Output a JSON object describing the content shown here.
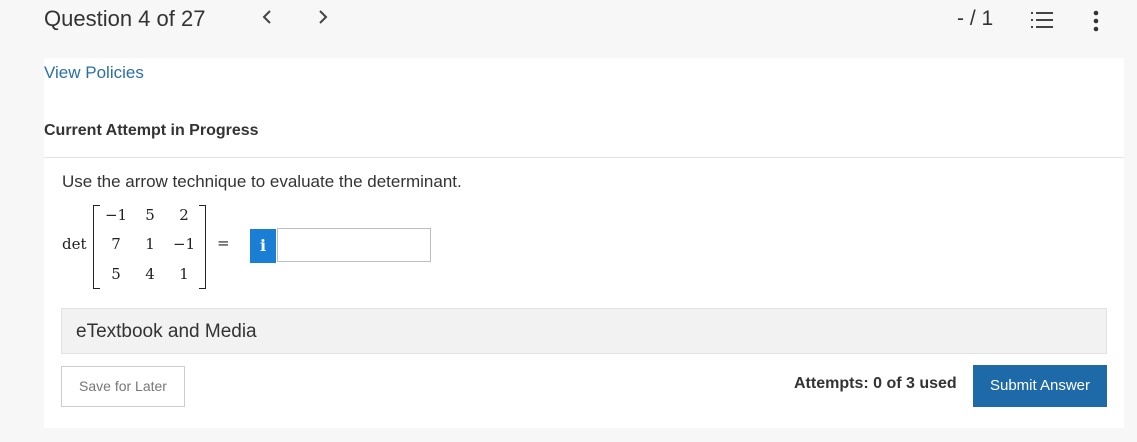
{
  "header": {
    "question_label": "Question 4 of 27",
    "prev_icon": "chevron-left-icon",
    "next_icon": "chevron-right-icon",
    "score": "- / 1",
    "list_icon": "numbered-list-icon",
    "more_icon": "vertical-dots-icon"
  },
  "policies_link": "View Policies",
  "attempt_title": "Current Attempt in Progress",
  "question": {
    "prompt": "Use the arrow technique to evaluate the determinant.",
    "det_label": "det",
    "matrix": [
      [
        "−1",
        "5",
        "2"
      ],
      [
        "7",
        "1",
        "−1"
      ],
      [
        "5",
        "4",
        "1"
      ]
    ],
    "equals": "=",
    "info_icon": "info-icon",
    "info_glyph": "i",
    "answer_value": ""
  },
  "etextbook_label": "eTextbook and Media",
  "footer": {
    "save_label": "Save for Later",
    "attempts_text": "Attempts: 0 of 3 used",
    "submit_label": "Submit Answer"
  },
  "colors": {
    "accent": "#1e6aa8",
    "info": "#1a7fd4",
    "link": "#2c6fa8"
  }
}
